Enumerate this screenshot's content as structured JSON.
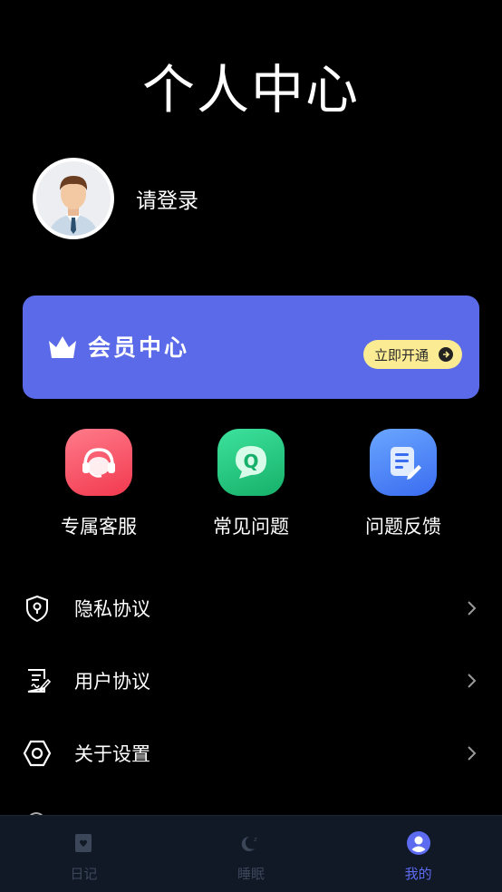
{
  "page": {
    "title": "个人中心"
  },
  "profile": {
    "login_text": "请登录",
    "avatar_icon": "avatar-icon"
  },
  "vip": {
    "title": "会员中心",
    "button_label": "立即开通",
    "card_color": "#5a6ae8",
    "button_color": "#fbeb93"
  },
  "quick_actions": [
    {
      "label": "专属客服",
      "icon": "headset-icon",
      "color": "#f2394f"
    },
    {
      "label": "常见问题",
      "icon": "faq-icon",
      "color": "#16b06a"
    },
    {
      "label": "问题反馈",
      "icon": "feedback-icon",
      "color": "#3a6cf0"
    }
  ],
  "menu": [
    {
      "label": "隐私协议",
      "icon": "shield-lock-icon"
    },
    {
      "label": "用户协议",
      "icon": "document-sign-icon"
    },
    {
      "label": "关于设置",
      "icon": "hexagon-settings-icon"
    }
  ],
  "tabbar": {
    "items": [
      {
        "label": "日记",
        "icon": "diary-icon",
        "active": false
      },
      {
        "label": "睡眠",
        "icon": "moon-icon",
        "active": false
      },
      {
        "label": "我的",
        "icon": "user-icon",
        "active": true
      }
    ],
    "active_color": "#5c6bf0",
    "inactive_color": "#3b4659"
  }
}
